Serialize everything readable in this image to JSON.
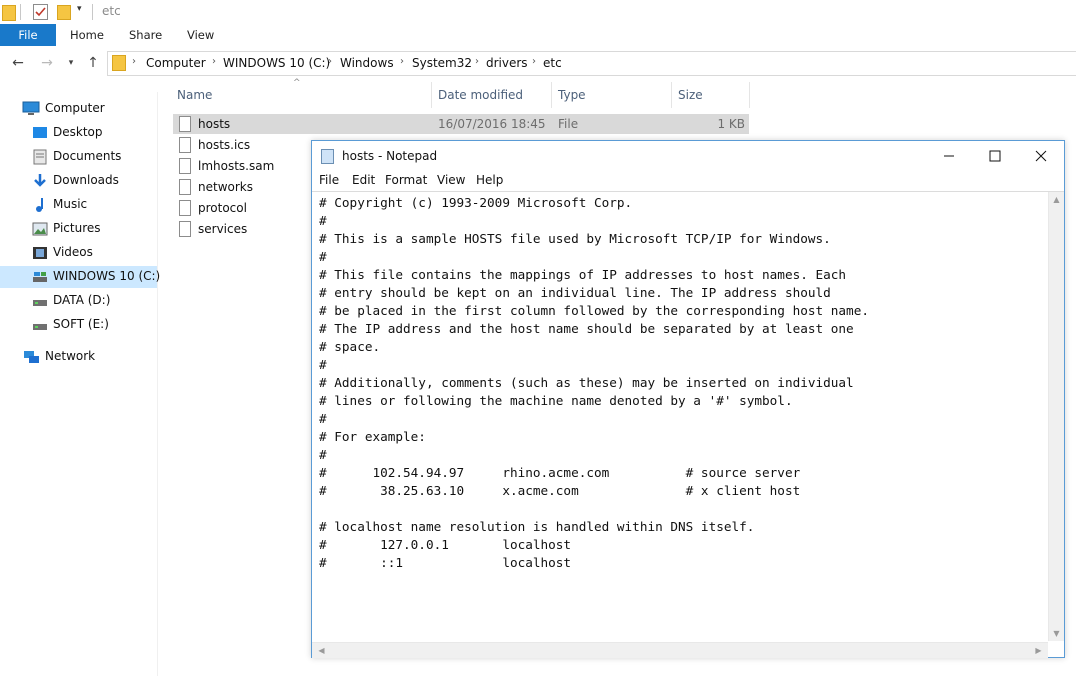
{
  "qat": {
    "path_hint": "etc"
  },
  "ribbon": {
    "tabs": [
      "File",
      "Home",
      "Share",
      "View"
    ]
  },
  "address": {
    "crumbs": [
      "Computer",
      "WINDOWS 10 (C:)",
      "Windows",
      "System32",
      "drivers",
      "etc"
    ]
  },
  "sidebar": {
    "items": [
      {
        "label": "Computer",
        "icon": "computer-icon"
      },
      {
        "label": "Desktop",
        "icon": "desktop-icon"
      },
      {
        "label": "Documents",
        "icon": "documents-icon"
      },
      {
        "label": "Downloads",
        "icon": "downloads-icon"
      },
      {
        "label": "Music",
        "icon": "music-icon"
      },
      {
        "label": "Pictures",
        "icon": "pictures-icon"
      },
      {
        "label": "Videos",
        "icon": "videos-icon"
      },
      {
        "label": "WINDOWS 10 (C:)",
        "icon": "drive-icon",
        "selected": true
      },
      {
        "label": "DATA (D:)",
        "icon": "drive-icon"
      },
      {
        "label": "SOFT (E:)",
        "icon": "drive-icon"
      },
      {
        "label": "Network",
        "icon": "network-icon"
      }
    ]
  },
  "filelist": {
    "columns": {
      "name": "Name",
      "date": "Date modified",
      "type": "Type",
      "size": "Size"
    },
    "files": [
      {
        "name": "hosts",
        "date": "16/07/2016 18:45",
        "type": "File",
        "size": "1 KB",
        "selected": true
      },
      {
        "name": "hosts.ics"
      },
      {
        "name": "lmhosts.sam"
      },
      {
        "name": "networks"
      },
      {
        "name": "protocol"
      },
      {
        "name": "services"
      }
    ]
  },
  "notepad": {
    "title": "hosts - Notepad",
    "menu": [
      "File",
      "Edit",
      "Format",
      "View",
      "Help"
    ],
    "text": "# Copyright (c) 1993-2009 Microsoft Corp.\n#\n# This is a sample HOSTS file used by Microsoft TCP/IP for Windows.\n#\n# This file contains the mappings of IP addresses to host names. Each\n# entry should be kept on an individual line. The IP address should\n# be placed in the first column followed by the corresponding host name.\n# The IP address and the host name should be separated by at least one\n# space.\n#\n# Additionally, comments (such as these) may be inserted on individual\n# lines or following the machine name denoted by a '#' symbol.\n#\n# For example:\n#\n#      102.54.94.97     rhino.acme.com          # source server\n#       38.25.63.10     x.acme.com              # x client host\n\n# localhost name resolution is handled within DNS itself.\n#\t127.0.0.1       localhost\n#\t::1             localhost"
  },
  "colors": {
    "accent": "#1979ca",
    "selection": "#cce8ff",
    "notepad_border": "#5a9bd5"
  }
}
